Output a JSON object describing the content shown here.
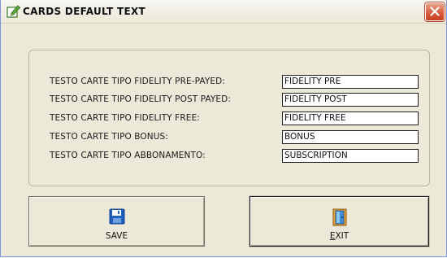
{
  "window": {
    "title": "CARDS DEFAULT TEXT",
    "title_icon": "edit-pencil-icon",
    "close_icon": "close-icon"
  },
  "fields": [
    {
      "label": "TESTO CARTE TIPO FIDELITY PRE-PAYED:",
      "value": "FIDELITY PRE"
    },
    {
      "label": "TESTO CARTE TIPO FIDELITY POST PAYED:",
      "value": "FIDELITY POST"
    },
    {
      "label": "TESTO CARTE TIPO FIDELITY FREE:",
      "value": "FIDELITY FREE"
    },
    {
      "label": "TESTO CARTE TIPO BONUS:",
      "value": "BONUS"
    },
    {
      "label": "TESTO CARTE TIPO ABBONAMENTO:",
      "value": "SUBSCRIPTION"
    }
  ],
  "buttons": {
    "save_label": "SAVE",
    "save_icon": "floppy-disk-icon",
    "exit_label": "EXIT",
    "exit_icon": "exit-door-icon"
  },
  "colors": {
    "window_bg": "#ece9d8",
    "close_button": "#d9573a",
    "floppy_blue": "#1f5fbf"
  }
}
